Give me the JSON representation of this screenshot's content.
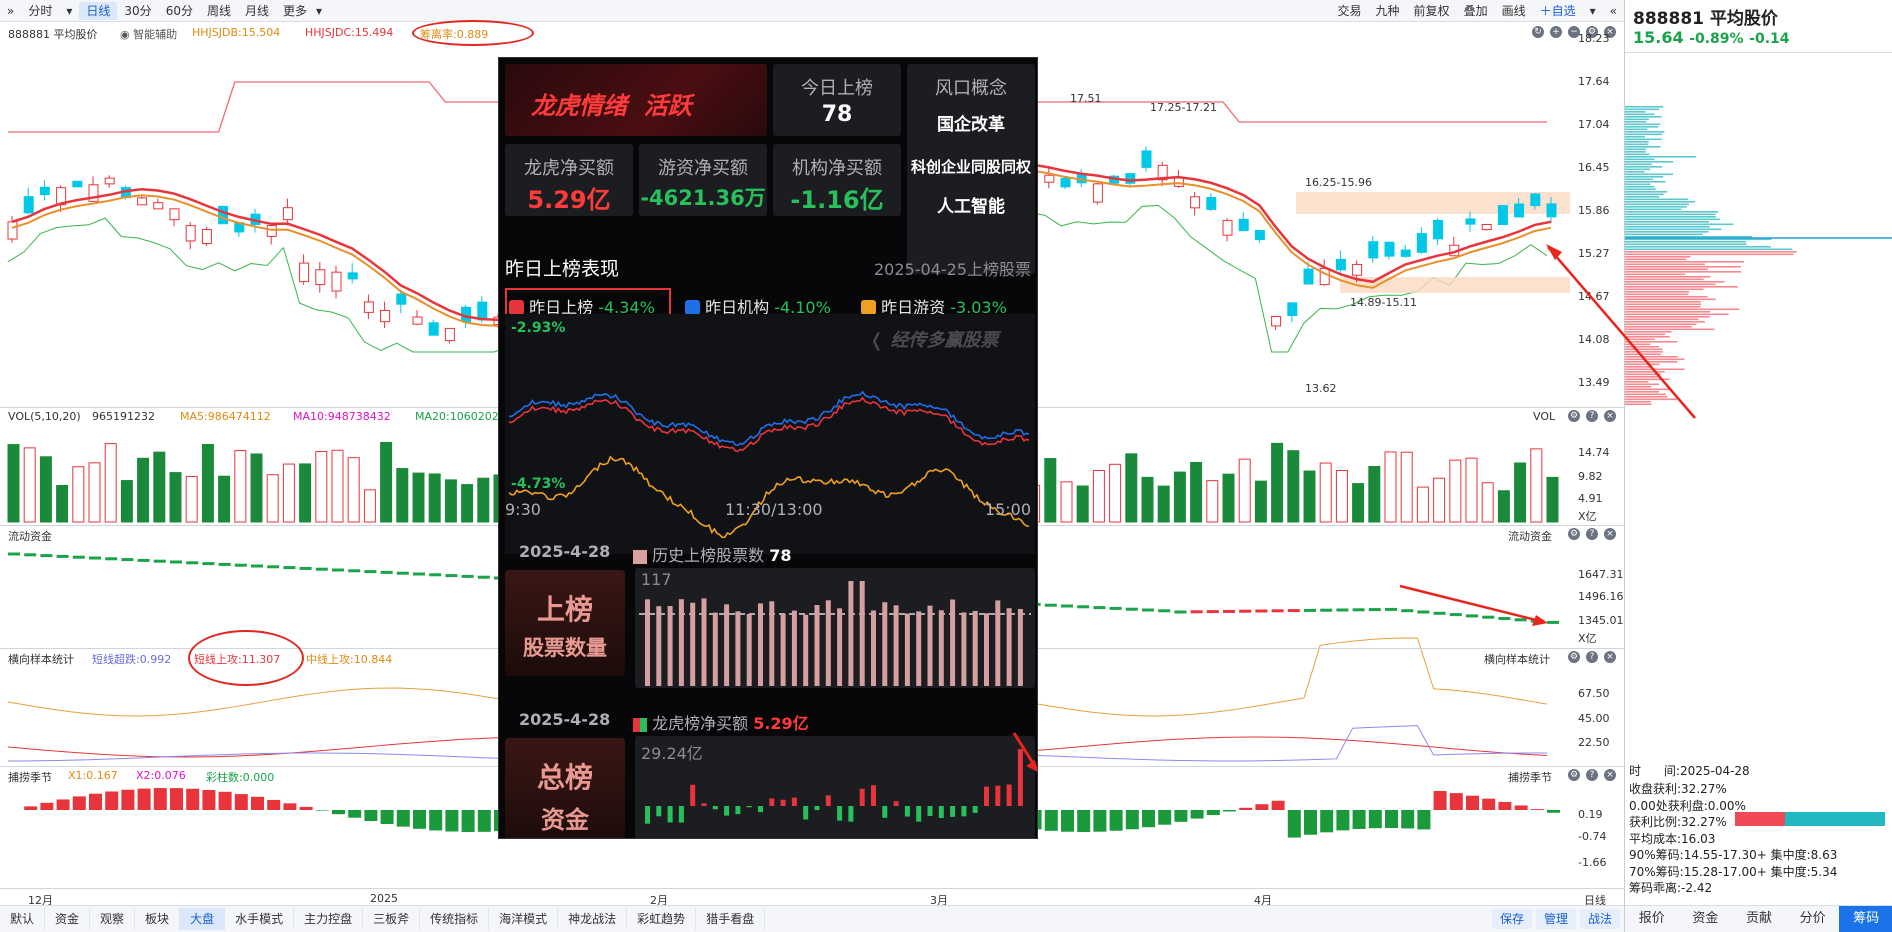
{
  "toolbar": {
    "left": [
      "分时",
      "日线",
      "30分",
      "60分",
      "周线",
      "月线",
      "更多"
    ],
    "active": "日线",
    "right": [
      "交易",
      "九种",
      "前复权",
      "叠加",
      "画线",
      "自选"
    ]
  },
  "main_chart": {
    "name": "888881 平均股价",
    "assist": "智能辅助",
    "hhjsjdb": "HHJSJDB:15.504",
    "hhjsjdc": "HHJSJDC:15.494",
    "tide": "筹离率:0.889",
    "price_labels": [
      "18.23",
      "17.64",
      "17.04",
      "16.45",
      "15.86",
      "15.27",
      "14.67",
      "14.08",
      "13.49"
    ],
    "annotations": [
      "17.51",
      "17.25-17.21",
      "16.25-15.96",
      "14.89-15.11",
      "13.62"
    ]
  },
  "vol_panel": {
    "title": "VOL(5,10,20)",
    "vol": "965191232",
    "ma5": "MA5:986474112",
    "ma10": "MA10:948738432",
    "ma20": "MA20:1060202",
    "right_title": "VOL",
    "axis": [
      "14.74",
      "9.82",
      "4.91",
      "X亿"
    ]
  },
  "flow_panel": {
    "title": "流动资金",
    "right_title": "流动资金",
    "axis": [
      "1647.31",
      "1496.16",
      "1345.01",
      "X亿"
    ]
  },
  "sample_panel": {
    "title": "横向样本统计",
    "short_fall": "短线超跌:0.992",
    "short_up": "短线上攻:11.307",
    "mid_up": "中线上攻:10.844",
    "right_title": "横向样本统计",
    "axis": [
      "67.50",
      "45.00",
      "22.50"
    ]
  },
  "season_panel": {
    "title": "捕捞季节",
    "x1": "X1:0.167",
    "x2": "X2:0.076",
    "bars": "彩柱数:0.000",
    "right_title": "捕捞季节",
    "axis": [
      "0.19",
      "-0.74",
      "-1.66"
    ]
  },
  "x_axis": [
    "12月",
    "2025",
    "2月",
    "3月",
    "4月"
  ],
  "x_axis_right": "日线",
  "overlay": {
    "title1": "龙虎情绪",
    "title2": "活跃",
    "today_label": "今日上榜",
    "today_value": "78",
    "wind_label": "风口概念",
    "concepts": [
      "国企改革",
      "科创企业同股同权",
      "人工智能"
    ],
    "lh_label": "龙虎净买额",
    "lh_value": "5.29亿",
    "yz_label": "游资净买额",
    "yz_value": "-4621.36万",
    "jg_label": "机构净买额",
    "jg_value": "-1.16亿",
    "perf_title": "昨日上榜表现",
    "perf_date": "2025-04-25上榜股票",
    "legend": [
      {
        "name": "昨日上榜",
        "value": "-4.34%",
        "color": "#e8343b"
      },
      {
        "name": "昨日机构",
        "value": "-4.10%",
        "color": "#1f6fe8"
      },
      {
        "name": "昨日游资",
        "value": "-3.03%",
        "color": "#f0a020"
      }
    ],
    "top_pct": "-2.93%",
    "bottom_pct": "-4.73%",
    "time_labels": [
      "9:30",
      "11:30/13:00",
      "15:00"
    ],
    "watermark": "经传多赢股票",
    "sec1_date": "2025-4-28",
    "sec1_legend": "历史上榜股票数",
    "sec1_value": "78",
    "sec1_max": "117",
    "sec1_btn1": "上榜",
    "sec1_btn2": "股票数量",
    "sec2_date": "2025-4-28",
    "sec2_legend": "龙虎榜净买额",
    "sec2_value": "5.29亿",
    "sec2_max": "29.24亿",
    "sec2_btn1": "总榜",
    "sec2_btn2": "资金"
  },
  "chip": {
    "title": "888881 平均股价",
    "price": "15.64",
    "pct": "-0.89%",
    "chg": "-0.14",
    "time_label": "时",
    "time_value": "间:2025-04-28",
    "stats": [
      "收盘获利:32.27%",
      "0.00处获利盘:0.00%",
      "获利比例:32.27%",
      "平均成本:16.03",
      "90%筹码:14.55-17.30+ 集中度:8.63",
      "70%筹码:15.28-17.00+ 集中度:5.34",
      "筹码乖离:-2.42"
    ]
  },
  "bottom_tabs": [
    "默认",
    "资金",
    "观察",
    "板块",
    "大盘",
    "水手模式",
    "主力控盘",
    "三板斧",
    "传统指标",
    "海洋模式",
    "神龙战法",
    "彩虹趋势",
    "猎手看盘"
  ],
  "bottom_active": "大盘",
  "bottom_right": [
    "保存",
    "管理",
    "战法"
  ],
  "right_tabs": [
    "报价",
    "资金",
    "贡献",
    "分价",
    "筹码"
  ],
  "right_active": "筹码",
  "colors": {
    "up": "#e8343b",
    "down": "#1aa34a",
    "cyan": "#00c8e6",
    "accent": "#1a73e8"
  }
}
